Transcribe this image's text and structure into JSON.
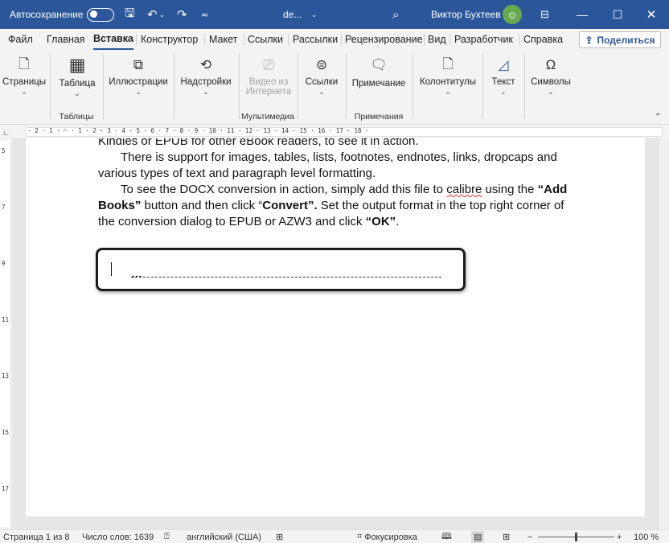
{
  "titlebar": {
    "autosave_label": "Автосохранение",
    "doc_name": "de...",
    "user_name": "Виктор Бухтеев",
    "icons": [
      "save-icon",
      "undo-icon",
      "redo-icon",
      "customize-icon",
      "search-icon",
      "ribbon-display-icon",
      "minimize-icon",
      "maximize-icon",
      "close-icon"
    ]
  },
  "tabs": [
    "Файл",
    "Главная",
    "Вставка",
    "Конструктор",
    "Макет",
    "Ссылки",
    "Рассылки",
    "Рецензирование",
    "Вид",
    "Разработчик",
    "Справка"
  ],
  "active_tab": "Вставка",
  "share_label": "Поделиться",
  "ribbon": {
    "pages": "Страницы",
    "table": "Таблица",
    "illustrations": "Иллюстрации",
    "addins": "Надстройки",
    "video_line1": "Видео из",
    "video_line2": "Интернета",
    "links": "Ссылки",
    "comment": "Примечание",
    "header_footer": "Колонтитулы",
    "text": "Текст",
    "symbols": "Символы",
    "groups": {
      "tables": "Таблицы",
      "media": "Мультимедиа",
      "comments": "Примечания"
    }
  },
  "ruler_text": "· 2 · 1 · ⌒ · 1 · 2 · 3 · 4 · 5 · 6 · 7 · 8 · 9 · 10 · 11 · 12 · 13 · 14 · 15 · 16 · 17 · 18 ·",
  "document": {
    "line0": "Kindles or EPUB for other eBook readers, to see it in action.",
    "para1": "There is support for images, tables, lists, footnotes, endnotes, links, dropcaps and various types of text and paragraph level formatting.",
    "p2_a": "To see the DOCX conversion in action, simply add this file to ",
    "p2_calibre": "calibre",
    "p2_b": " using the",
    "p2_addbooks": "“Add Books”",
    "p2_c": " button and then click “",
    "p2_convert": "Convert”.",
    "p2_d": "  Set the output format in the top right corner of the conversion dialog to EPUB or AZW3 and click ",
    "p2_ok": "“OK”",
    "p2_e": ".",
    "leader_dots": "…"
  },
  "status": {
    "page": "Страница 1 из 8",
    "words": "Число слов: 1639",
    "language": "английский (США)",
    "focus": "Фокусировка",
    "zoom_minus": "−",
    "zoom_plus": "+",
    "zoom": "100 %"
  },
  "colors": {
    "titlebar": "#2b579a",
    "accent": "#2b579a",
    "highlight_border": "#1a1a1a"
  }
}
